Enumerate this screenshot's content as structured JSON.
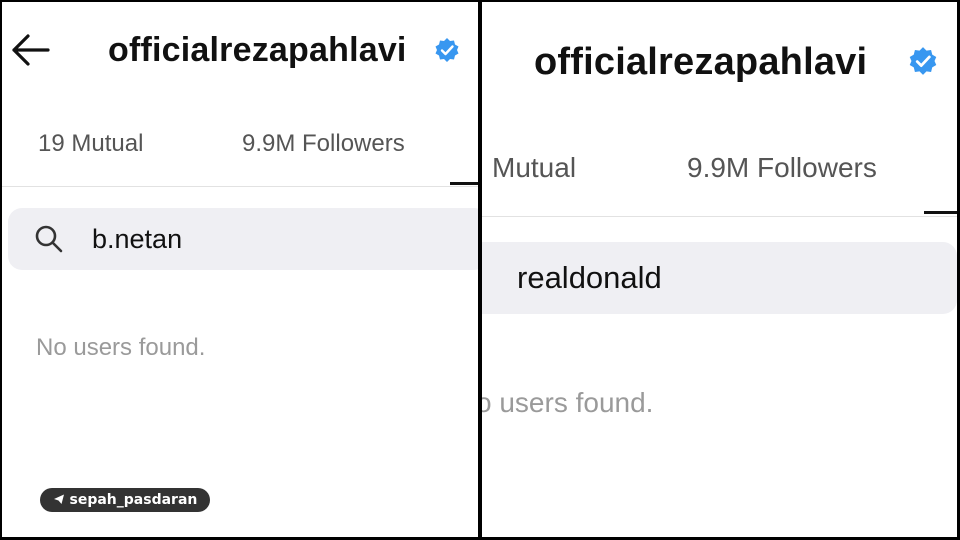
{
  "left": {
    "username": "officialrezapahlavi",
    "tabs": {
      "mutual": "19 Mutual",
      "followers": "9.9M Followers"
    },
    "search_query": "b.netan",
    "empty_state": "No users found."
  },
  "right": {
    "username": "officialrezapahlavi",
    "tabs": {
      "mutual": "Mutual",
      "followers": "9.9M Followers"
    },
    "search_query": "realdonald",
    "empty_state": "o users found."
  },
  "watermark": "sepah_pasdaran",
  "icons": {
    "back": "back-arrow-icon",
    "verified": "verified-badge-icon",
    "search": "search-icon",
    "telegram": "telegram-icon"
  },
  "colors": {
    "verified_blue": "#3897f0",
    "search_bg": "#efeff3",
    "empty_text": "#9a9a9a",
    "divider": "#e2e2e2",
    "watermark_bg": "#333333"
  }
}
